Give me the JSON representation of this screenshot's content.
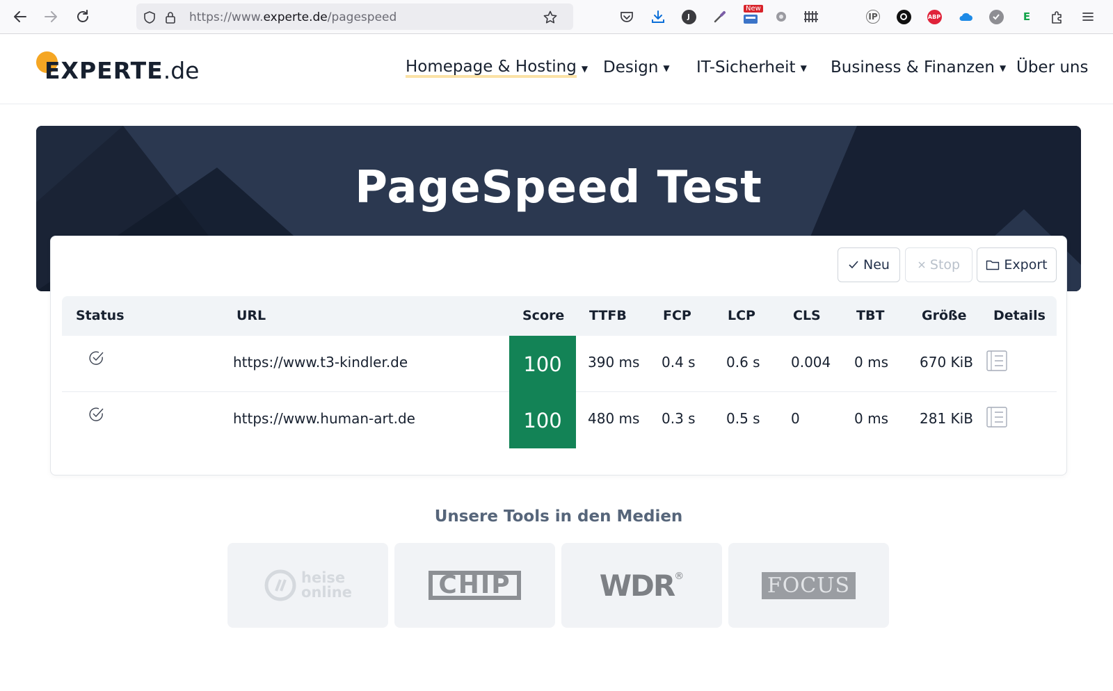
{
  "browser": {
    "url_prefix": "https://www.",
    "url_host": "experte.de",
    "url_path": "/pagespeed",
    "extensions": [
      "pocket-icon",
      "download-icon",
      "j-extension-icon",
      "eyedropper-icon",
      "new-badge-extension-icon",
      "gear-extension-icon",
      "grid-extension-icon",
      "ip-extension-icon",
      "e-circle-extension-icon",
      "adblock-plus-icon",
      "cloud-extension-icon",
      "check-extension-icon",
      "e-green-extension-icon",
      "puzzle-extensions-icon",
      "menu-icon"
    ],
    "ext_labels": {
      "j": "J",
      "new": "New",
      "abp": "ABP",
      "e": "E",
      "ip": "IP"
    }
  },
  "site": {
    "logo_main": "EXPERTE",
    "logo_tld": ".de",
    "nav": [
      {
        "label": "Homepage & Hosting",
        "dropdown": true
      },
      {
        "label": "Design",
        "dropdown": true
      },
      {
        "label": "IT-Sicherheit",
        "dropdown": true
      },
      {
        "label": "Business & Finanzen",
        "dropdown": true
      },
      {
        "label": "Über uns",
        "dropdown": false
      }
    ]
  },
  "hero": {
    "title": "PageSpeed Test"
  },
  "actions": {
    "new_label": "Neu",
    "stop_label": "Stop",
    "export_label": "Export"
  },
  "table": {
    "headers": [
      "Status",
      "URL",
      "Score",
      "TTFB",
      "FCP",
      "LCP",
      "CLS",
      "TBT",
      "Größe",
      "Details"
    ],
    "rows": [
      {
        "url": "https://www.t3-kindler.de",
        "score": "100",
        "ttfb": "390 ms",
        "fcp": "0.4 s",
        "lcp": "0.6 s",
        "cls": "0.004",
        "tbt": "0 ms",
        "size": "670 KiB"
      },
      {
        "url": "https://www.human-art.de",
        "score": "100",
        "ttfb": "480 ms",
        "fcp": "0.3 s",
        "lcp": "0.5 s",
        "cls": "0",
        "tbt": "0 ms",
        "size": "281 KiB"
      }
    ]
  },
  "media": {
    "title": "Unsere Tools in den Medien",
    "logos": [
      {
        "name": "heise",
        "line1": "heise",
        "line2": "online"
      },
      {
        "name": "chip",
        "text": "CHIP"
      },
      {
        "name": "wdr",
        "text": "WDR"
      },
      {
        "name": "focus",
        "text": "FOCUS"
      }
    ]
  },
  "colors": {
    "score_green": "#138356",
    "hero_dark": "#1a2335",
    "accent_orange": "#f5a623",
    "nav_underline": "#fbe2a6"
  }
}
